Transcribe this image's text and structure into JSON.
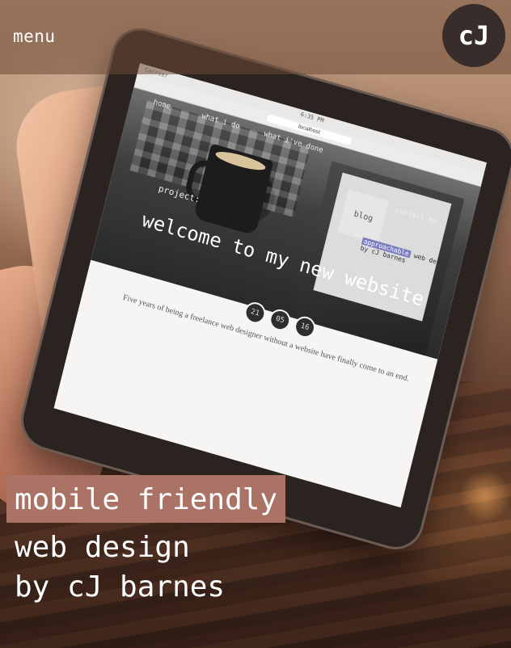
{
  "header": {
    "menu_label": "menu",
    "logo_text": "cJ"
  },
  "tablet": {
    "carrier": "Carrier",
    "time": "6:35 PM",
    "url": "localhost",
    "nav": {
      "home": "home",
      "what_i_do": "what i do",
      "what_ive_done": "what i've done",
      "blog": "blog",
      "contact_me": "contact me"
    },
    "mini_tag": {
      "highlight": "approachable",
      "rest1": "web design",
      "rest2": "by cJ barnes"
    },
    "project_label": "project:",
    "project_title": "welcome to my new website",
    "date": {
      "day": "21",
      "month": "05",
      "year": "16"
    },
    "excerpt": "Five years of being a freelance web designer without a website have finally come to an end."
  },
  "tagline": {
    "line1": "mobile friendly",
    "line2": "web design",
    "line3": "by cJ barnes",
    "highlight_color": "#ab7266"
  }
}
